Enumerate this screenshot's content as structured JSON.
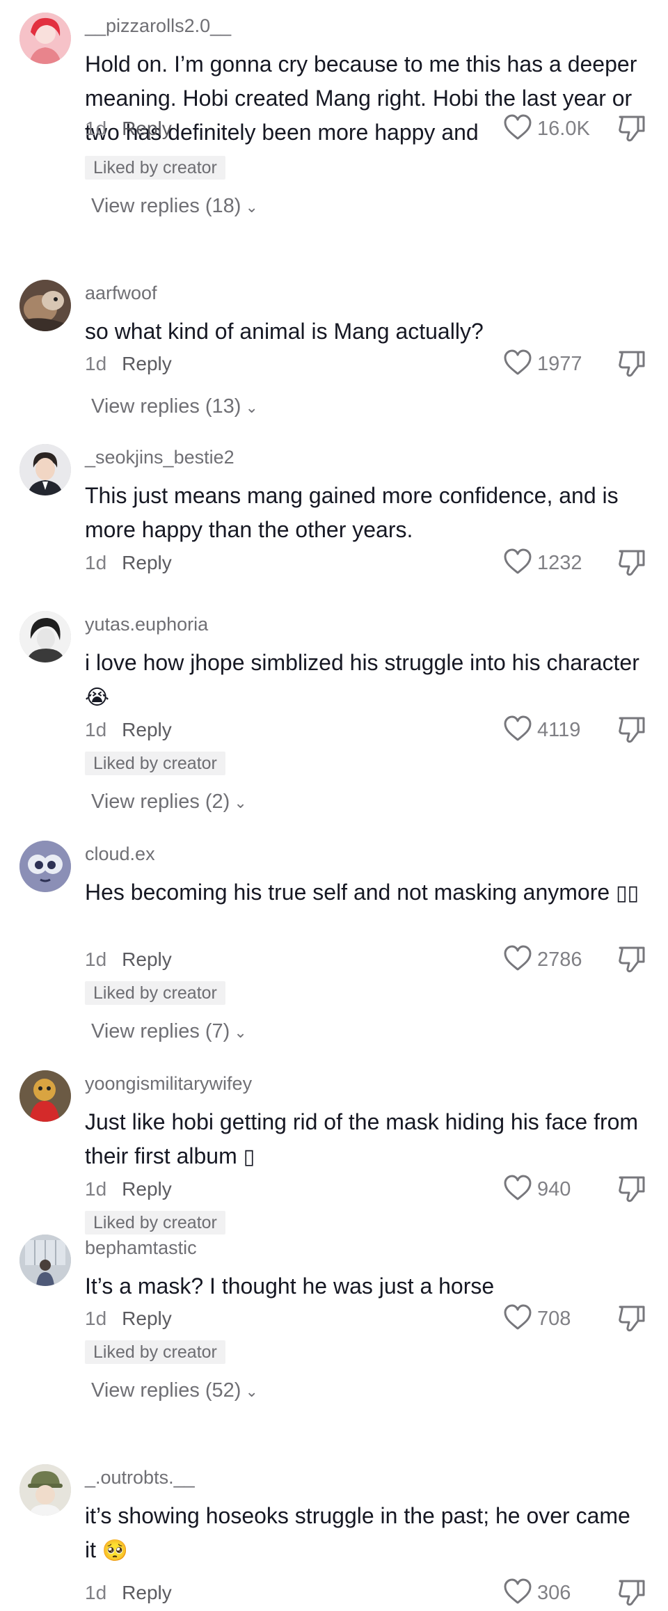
{
  "comments": [
    {
      "username": "__pizzarolls2.0__",
      "text": "Hold on. I’m gonna cry because to me this has a deeper meaning. Hobi created Mang right. Hobi the last year or two has definitely been more happy and",
      "time": "1d",
      "reply_label": "Reply",
      "likes": "16.0K",
      "badge": "Liked by creator",
      "view_replies": "View replies (18)"
    },
    {
      "username": "aarfwoof",
      "text": "so what kind of animal is Mang actually?",
      "time": "1d",
      "reply_label": "Reply",
      "likes": "1977",
      "view_replies": "View replies (13)"
    },
    {
      "username": "_seokjins_bestie2",
      "text": "This just means mang gained more confidence, and is more happy than the other years.",
      "time": "1d",
      "reply_label": "Reply",
      "likes": "1232"
    },
    {
      "username": "yutas.euphoria",
      "text": "i love how jhope simblized his struggle into his character",
      "emoji": "😭",
      "time": "1d",
      "reply_label": "Reply",
      "likes": "4119",
      "badge": "Liked by creator",
      "view_replies": "View replies (2)"
    },
    {
      "username": "cloud.ex",
      "text": "Hes becoming his true self and not masking anymore",
      "emoji": "▯▯",
      "time": "1d",
      "reply_label": "Reply",
      "likes": "2786",
      "badge": "Liked by creator",
      "view_replies": "View replies (7)"
    },
    {
      "username": "yoongismilitarywifey",
      "text": "Just like hobi getting rid of the mask hiding his face from their first album",
      "emoji": "▯",
      "time": "1d",
      "reply_label": "Reply",
      "likes": "940",
      "badge": "Liked by creator"
    },
    {
      "username": "bephamtastic",
      "text": "It’s a mask? I thought he was just a horse",
      "time": "1d",
      "reply_label": "Reply",
      "likes": "708",
      "badge": "Liked by creator",
      "view_replies": "View replies (52)"
    },
    {
      "username": "_.outrobts.__",
      "text": "it’s showing hoseoks struggle in the past; he over came it",
      "emoji": "🥺",
      "time": "1d",
      "reply_label": "Reply",
      "likes": "306"
    }
  ],
  "icons": {
    "like": "heart-outline-icon",
    "dislike": "thumbs-down-icon",
    "expand": "chevron-down-icon"
  },
  "colors": {
    "text": "#161823",
    "muted": "#808085",
    "badge_bg": "#f1f1f2"
  }
}
